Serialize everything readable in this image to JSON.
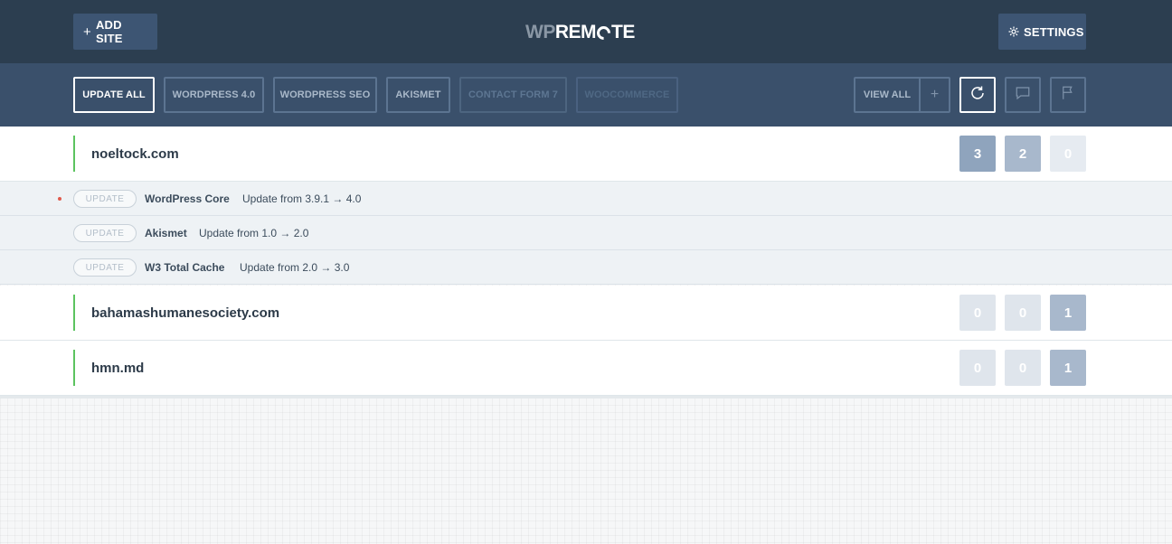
{
  "header": {
    "add_site_label": "ADD SITE",
    "logo_wp": "WP",
    "logo_rem": "REM",
    "logo_te": "TE",
    "settings_label": "SETTINGS"
  },
  "filters": {
    "update_all": "UPDATE ALL",
    "wordpress": "WORDPRESS 4.0",
    "wordpress_seo": "WORDPRESS SEO",
    "akismet": "AKISMET",
    "contact_form": "CONTACT FORM 7",
    "woocommerce": "WOOCOMMERCE",
    "view_all": "VIEW ALL",
    "plus": "+"
  },
  "sites": [
    {
      "name": "noeltock.com",
      "counts": [
        "3",
        "2",
        "0"
      ],
      "updates": [
        {
          "button": "UPDATE",
          "plugin": "WordPress Core",
          "text": "Update from 3.9.1 → 4.0"
        },
        {
          "button": "UPDATE",
          "plugin": "Akismet",
          "text": "Update from 1.0 → 2.0"
        },
        {
          "button": "UPDATE",
          "plugin": "W3 Total Cache",
          "text": "Update from 2.0 → 3.0"
        }
      ]
    },
    {
      "name": "bahamashumanesociety.com",
      "counts": [
        "0",
        "0",
        "1"
      ]
    },
    {
      "name": "hmn.md",
      "counts": [
        "0",
        "0",
        "1"
      ]
    }
  ],
  "colors": {
    "header_bg": "#2c3e50",
    "filterbar_bg": "#3a506b",
    "status_green": "#5cc35f",
    "alert_red": "#e05a4b"
  }
}
